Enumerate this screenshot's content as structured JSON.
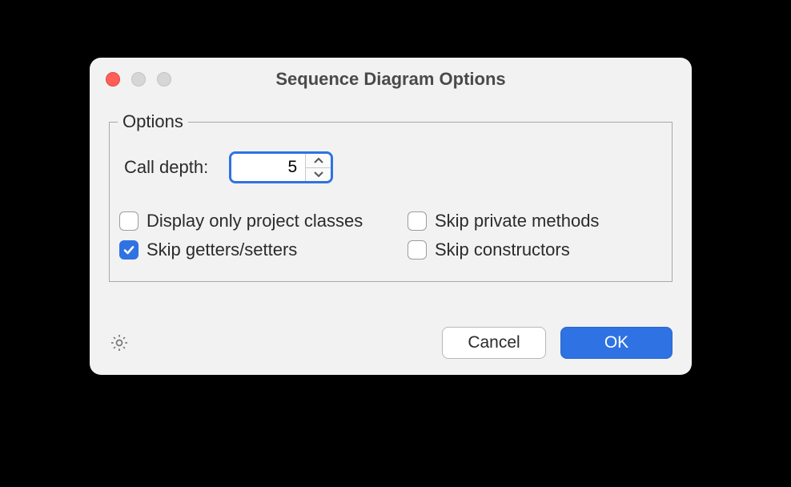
{
  "dialog": {
    "title": "Sequence Diagram Options"
  },
  "options": {
    "legend": "Options",
    "call_depth_label": "Call depth:",
    "call_depth_value": "5",
    "checkboxes": {
      "display_project_classes": {
        "label": "Display only project classes",
        "checked": false
      },
      "skip_private_methods": {
        "label": "Skip private methods",
        "checked": false
      },
      "skip_getters_setters": {
        "label": "Skip getters/setters",
        "checked": true
      },
      "skip_constructors": {
        "label": "Skip constructors",
        "checked": false
      }
    }
  },
  "buttons": {
    "cancel": "Cancel",
    "ok": "OK"
  }
}
